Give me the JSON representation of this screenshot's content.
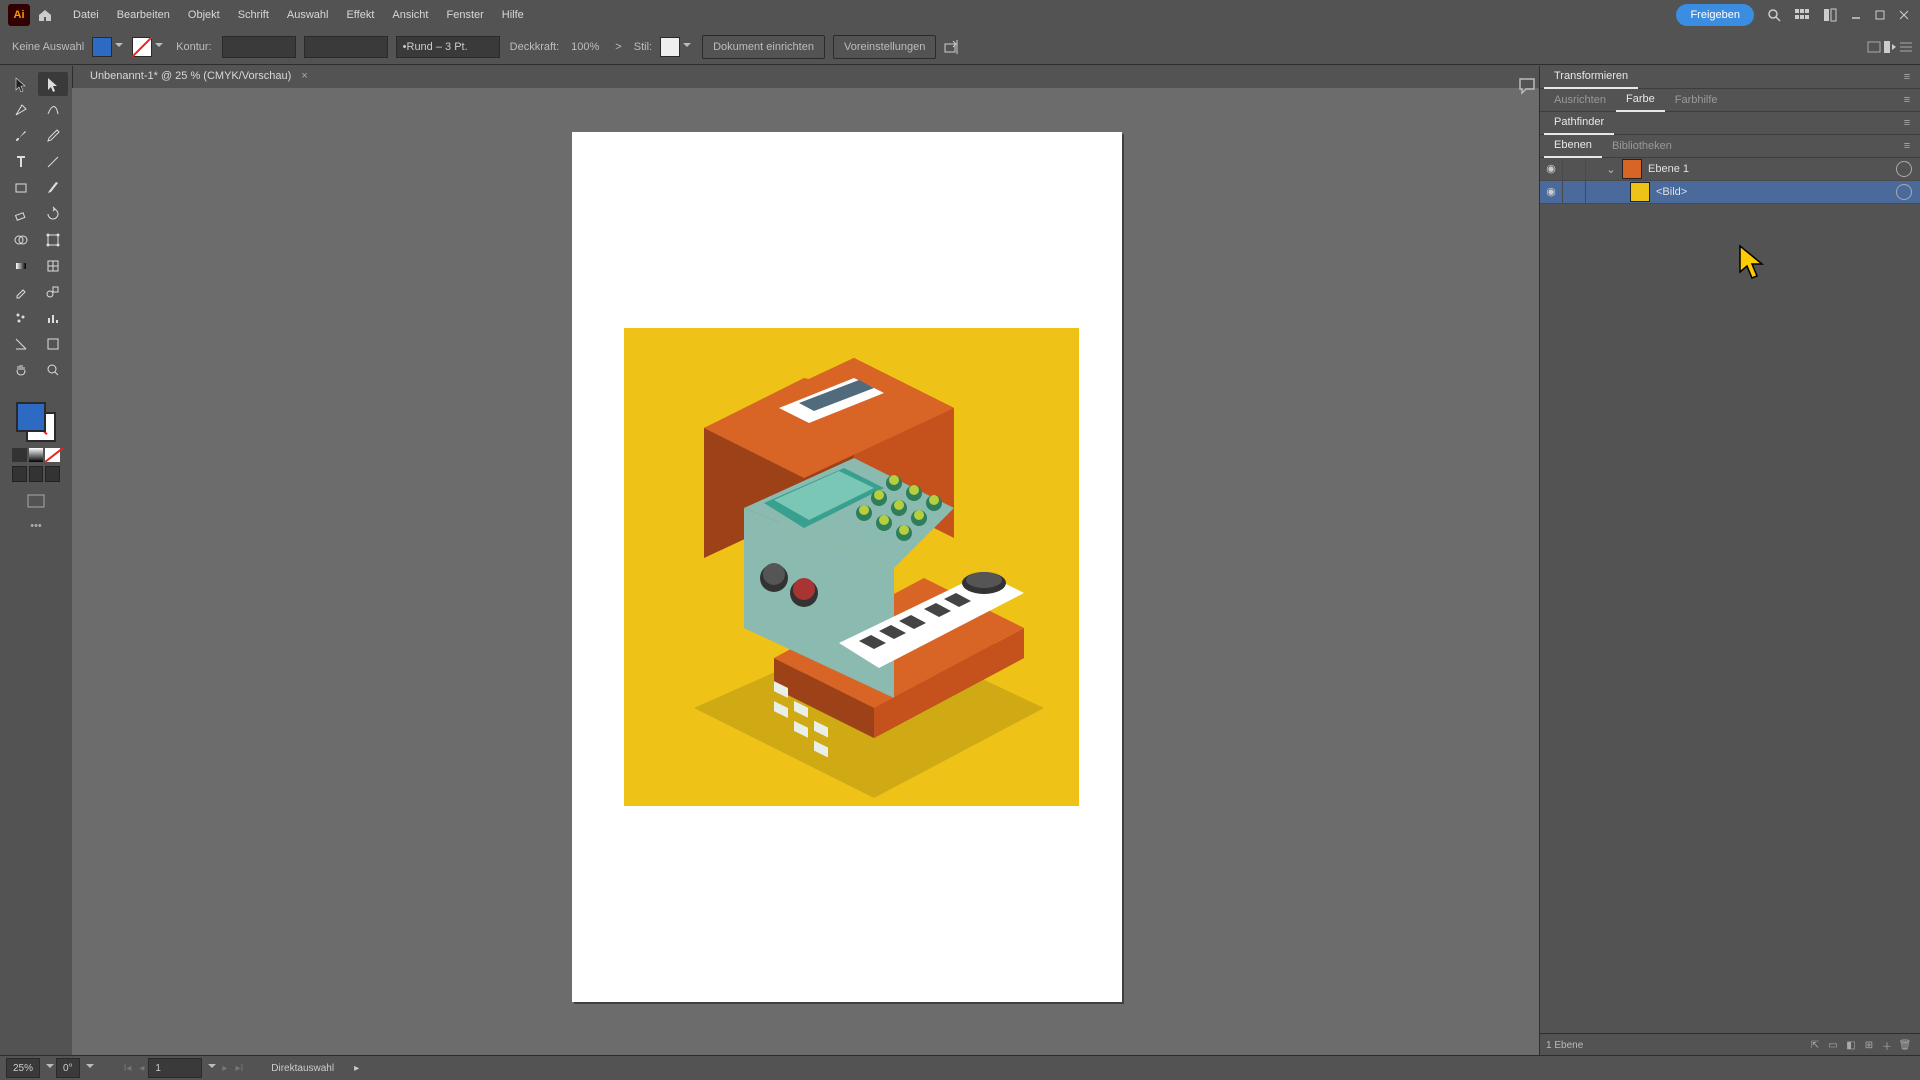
{
  "menu": {
    "items": [
      "Datei",
      "Bearbeiten",
      "Objekt",
      "Schrift",
      "Auswahl",
      "Effekt",
      "Ansicht",
      "Fenster",
      "Hilfe"
    ],
    "share": "Freigeben"
  },
  "optbar": {
    "noSelection": "Keine Auswahl",
    "fill": "#2c6ac4",
    "stroke": "#ffffff",
    "konturLabel": "Kontur:",
    "konturVal": "",
    "brushLabel": "Rund – 3 Pt.",
    "opacityLabel": "Deckkraft:",
    "opacityVal": "100%",
    "styleLabel": "Stil:",
    "docSetup": "Dokument einrichten",
    "prefs": "Voreinstellungen"
  },
  "tab": {
    "title": "Unbenannt-1* @ 25 % (CMYK/Vorschau)"
  },
  "tools": {
    "names": [
      "selection-tool",
      "direct-selection-tool",
      "pen-tool",
      "curvature-tool",
      "brush-tool",
      "pencil-tool",
      "type-tool",
      "line-tool",
      "rectangle-tool",
      "paintbrush-tool",
      "eraser-tool",
      "rotate-tool",
      "shape-builder-tool",
      "free-transform-tool",
      "gradient-tool",
      "mesh-tool",
      "eyedropper-tool",
      "blend-tool",
      "symbol-sprayer-tool",
      "column-graph-tool",
      "slice-tool",
      "artboard-tool",
      "hand-tool",
      "zoom-tool"
    ]
  },
  "rpanel": {
    "transform": "Transformieren",
    "align": "Ausrichten",
    "color": "Farbe",
    "colorHelp": "Farbhilfe",
    "pathfinder": "Pathfinder",
    "layersTab": "Ebenen",
    "librariesTab": "Bibliotheken",
    "layer1": "Ebene 1",
    "sublayer": "<Bild>",
    "footer": "1 Ebene"
  },
  "status": {
    "zoom": "25%",
    "rotate": "0°",
    "artboard": "1",
    "mode": "Direktauswahl"
  }
}
